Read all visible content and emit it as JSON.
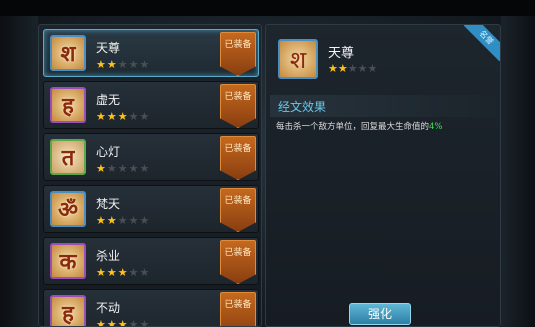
{
  "list": {
    "items": [
      {
        "name": "天尊",
        "stars": 2,
        "max_stars": 5,
        "badge": "已装备",
        "glyph": "श",
        "frame": "blue",
        "selected": true
      },
      {
        "name": "虚无",
        "stars": 3,
        "max_stars": 5,
        "badge": "已装备",
        "glyph": "ह",
        "frame": "purple",
        "selected": false
      },
      {
        "name": "心灯",
        "stars": 1,
        "max_stars": 5,
        "badge": "已装备",
        "glyph": "त",
        "frame": "green",
        "selected": false
      },
      {
        "name": "梵天",
        "stars": 2,
        "max_stars": 5,
        "badge": "已装备",
        "glyph": "ॐ",
        "frame": "blue",
        "selected": false
      },
      {
        "name": "杀业",
        "stars": 3,
        "max_stars": 5,
        "badge": "已装备",
        "glyph": "क",
        "frame": "purple",
        "selected": false
      },
      {
        "name": "不动",
        "stars": 3,
        "max_stars": 5,
        "badge": "已装备",
        "glyph": "ह",
        "frame": "purple",
        "selected": false
      }
    ]
  },
  "detail": {
    "name": "天尊",
    "stars": 2,
    "max_stars": 5,
    "glyph": "श",
    "corner_tag": "名誉",
    "section_title": "经文效果",
    "desc_prefix": "每击杀一个敌方单位，回复最大生命值的",
    "desc_value": "4%",
    "enhance_button": "强化"
  },
  "colors": {
    "star_on": "#ffc21a",
    "star_off": "#4a4f54",
    "highlight_green": "#3ee05a",
    "section_title": "#69c7ea",
    "badge": "#c4691e"
  }
}
